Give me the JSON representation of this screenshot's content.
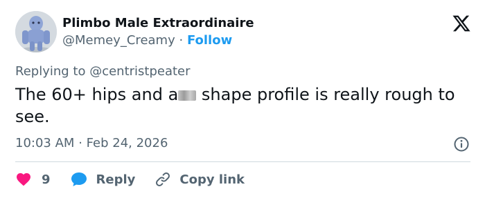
{
  "author": {
    "display_name": "Plimbo Male Extraordinaire",
    "handle": "@Memey_Creamy",
    "separator": "·",
    "follow_label": "Follow"
  },
  "reply_to": "Replying to @centristpeater",
  "tweet": {
    "text_before": "The 60+ hips and a",
    "text_after": " shape profile is really rough to see."
  },
  "meta": {
    "time": "10:03 AM",
    "separator": "·",
    "date": "Feb 24, 2026"
  },
  "actions": {
    "like_count": "9",
    "reply_label": "Reply",
    "copy_label": "Copy link"
  },
  "colors": {
    "text": "#0f1419",
    "secondary": "#536471",
    "link": "#1d9bf0",
    "like": "#f91880",
    "divider": "#cfd9de"
  }
}
